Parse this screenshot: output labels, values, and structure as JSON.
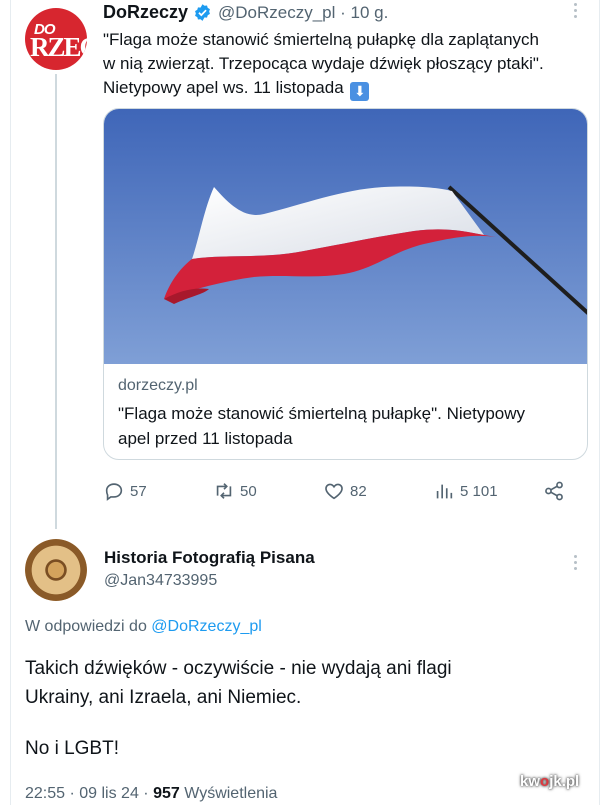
{
  "tweet1": {
    "author_name": "DoRzeczy",
    "handle": "@DoRzeczy_pl",
    "time": "· 10 g.",
    "avatar_text": {
      "top": "DO",
      "main": "RZEC"
    },
    "text_lines": [
      "\"Flaga może stanowić śmiertelną pułapkę dla zaplątanych",
      "w nią zwierząt. Trzepocąca wydaje dźwięk płoszący ptaki\".",
      "Nietypowy apel ws. 11 listopada"
    ],
    "emoji": "⬇",
    "card": {
      "domain": "dorzeczy.pl",
      "title_lines": [
        "\"Flaga może stanowić śmiertelną pułapkę\". Nietypowy",
        "apel przed 11 listopada"
      ]
    },
    "actions": {
      "replies": "57",
      "retweets": "50",
      "likes": "82",
      "views": "5 101"
    }
  },
  "tweet2": {
    "author_name": "Historia Fotografią Pisana",
    "handle": "@Jan34733995",
    "reply_prefix": "W odpowiedzi do",
    "reply_mention": "@DoRzeczy_pl",
    "text_lines": [
      "Takich dźwięków - oczywiście - nie wydają ani flagi",
      "Ukrainy, ani Izraela, ani Niemiec."
    ],
    "text_line_after_gap": "No i LGBT!",
    "meta_date": "22:55 · 09 lis 24 · ",
    "meta_views_count": "957",
    "meta_views_label": " Wyświetlenia"
  },
  "watermark": {
    "pre": "kw",
    "o": "o",
    "post": "jk.pl"
  },
  "colors": {
    "accent": "#1d9bf0",
    "muted": "#536471",
    "brand_red": "#d7262f",
    "sky": "#5a7fc6"
  }
}
